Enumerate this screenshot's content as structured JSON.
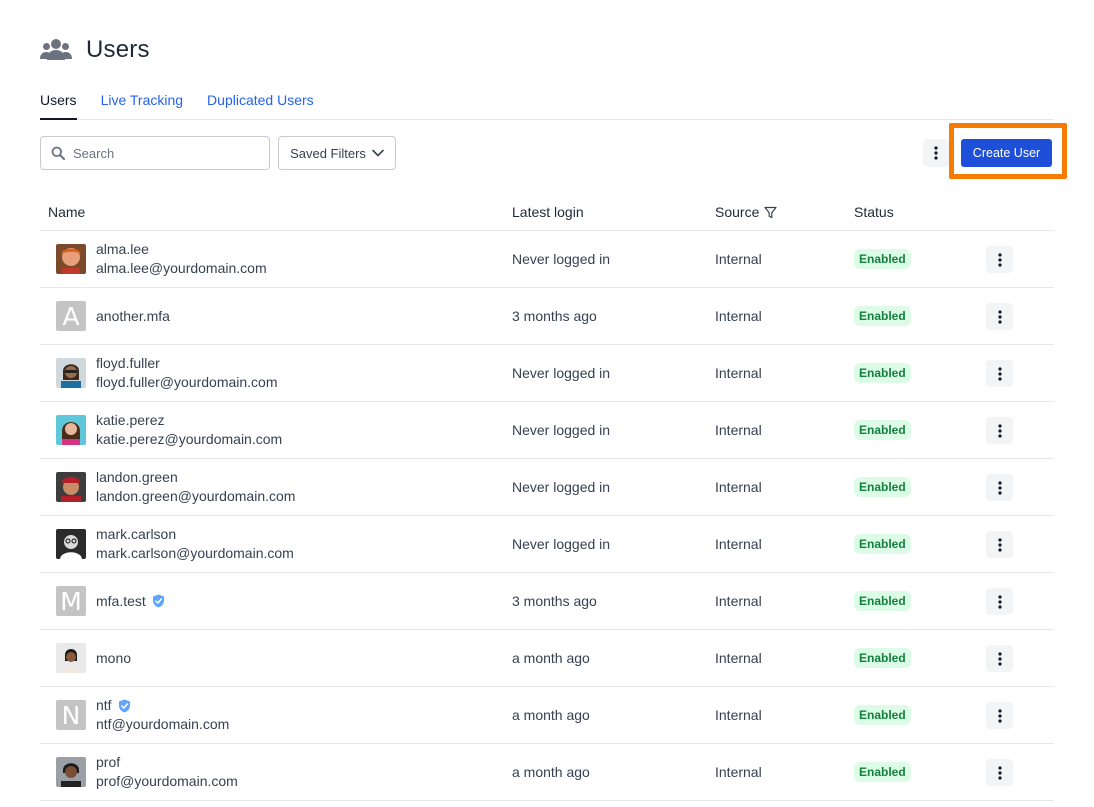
{
  "header": {
    "title": "Users",
    "icon": "users-icon"
  },
  "tabs": [
    {
      "label": "Users",
      "active": true
    },
    {
      "label": "Live Tracking",
      "active": false
    },
    {
      "label": "Duplicated Users",
      "active": false
    }
  ],
  "toolbar": {
    "search_placeholder": "Search",
    "saved_filters_label": "Saved Filters",
    "create_user_label": "Create User",
    "highlight_color": "#f57c00",
    "accent_color": "#1e4fd8"
  },
  "table": {
    "columns": {
      "name": "Name",
      "latest_login": "Latest login",
      "source": "Source",
      "status": "Status"
    },
    "rows": [
      {
        "username": "alma.lee",
        "email": "alma.lee@yourdomain.com",
        "latest_login": "Never logged in",
        "source": "Internal",
        "status": "Enabled",
        "avatar": "photo",
        "avatar_letter": "",
        "verified": false
      },
      {
        "username": "another.mfa",
        "email": "",
        "latest_login": "3 months ago",
        "source": "Internal",
        "status": "Enabled",
        "avatar": "letter",
        "avatar_letter": "A",
        "verified": false
      },
      {
        "username": "floyd.fuller",
        "email": "floyd.fuller@yourdomain.com",
        "latest_login": "Never logged in",
        "source": "Internal",
        "status": "Enabled",
        "avatar": "photo",
        "avatar_letter": "",
        "verified": false
      },
      {
        "username": "katie.perez",
        "email": "katie.perez@yourdomain.com",
        "latest_login": "Never logged in",
        "source": "Internal",
        "status": "Enabled",
        "avatar": "photo",
        "avatar_letter": "",
        "verified": false
      },
      {
        "username": "landon.green",
        "email": "landon.green@yourdomain.com",
        "latest_login": "Never logged in",
        "source": "Internal",
        "status": "Enabled",
        "avatar": "photo",
        "avatar_letter": "",
        "verified": false
      },
      {
        "username": "mark.carlson",
        "email": "mark.carlson@yourdomain.com",
        "latest_login": "Never logged in",
        "source": "Internal",
        "status": "Enabled",
        "avatar": "photo",
        "avatar_letter": "",
        "verified": false
      },
      {
        "username": "mfa.test",
        "email": "",
        "latest_login": "3 months ago",
        "source": "Internal",
        "status": "Enabled",
        "avatar": "letter",
        "avatar_letter": "M",
        "verified": true
      },
      {
        "username": "mono",
        "email": "",
        "latest_login": "a month ago",
        "source": "Internal",
        "status": "Enabled",
        "avatar": "photo",
        "avatar_letter": "",
        "verified": false
      },
      {
        "username": "ntf",
        "email": "ntf@yourdomain.com",
        "latest_login": "a month ago",
        "source": "Internal",
        "status": "Enabled",
        "avatar": "letter",
        "avatar_letter": "N",
        "verified": true
      },
      {
        "username": "prof",
        "email": "prof@yourdomain.com",
        "latest_login": "a month ago",
        "source": "Internal",
        "status": "Enabled",
        "avatar": "photo",
        "avatar_letter": "",
        "verified": false
      }
    ]
  }
}
